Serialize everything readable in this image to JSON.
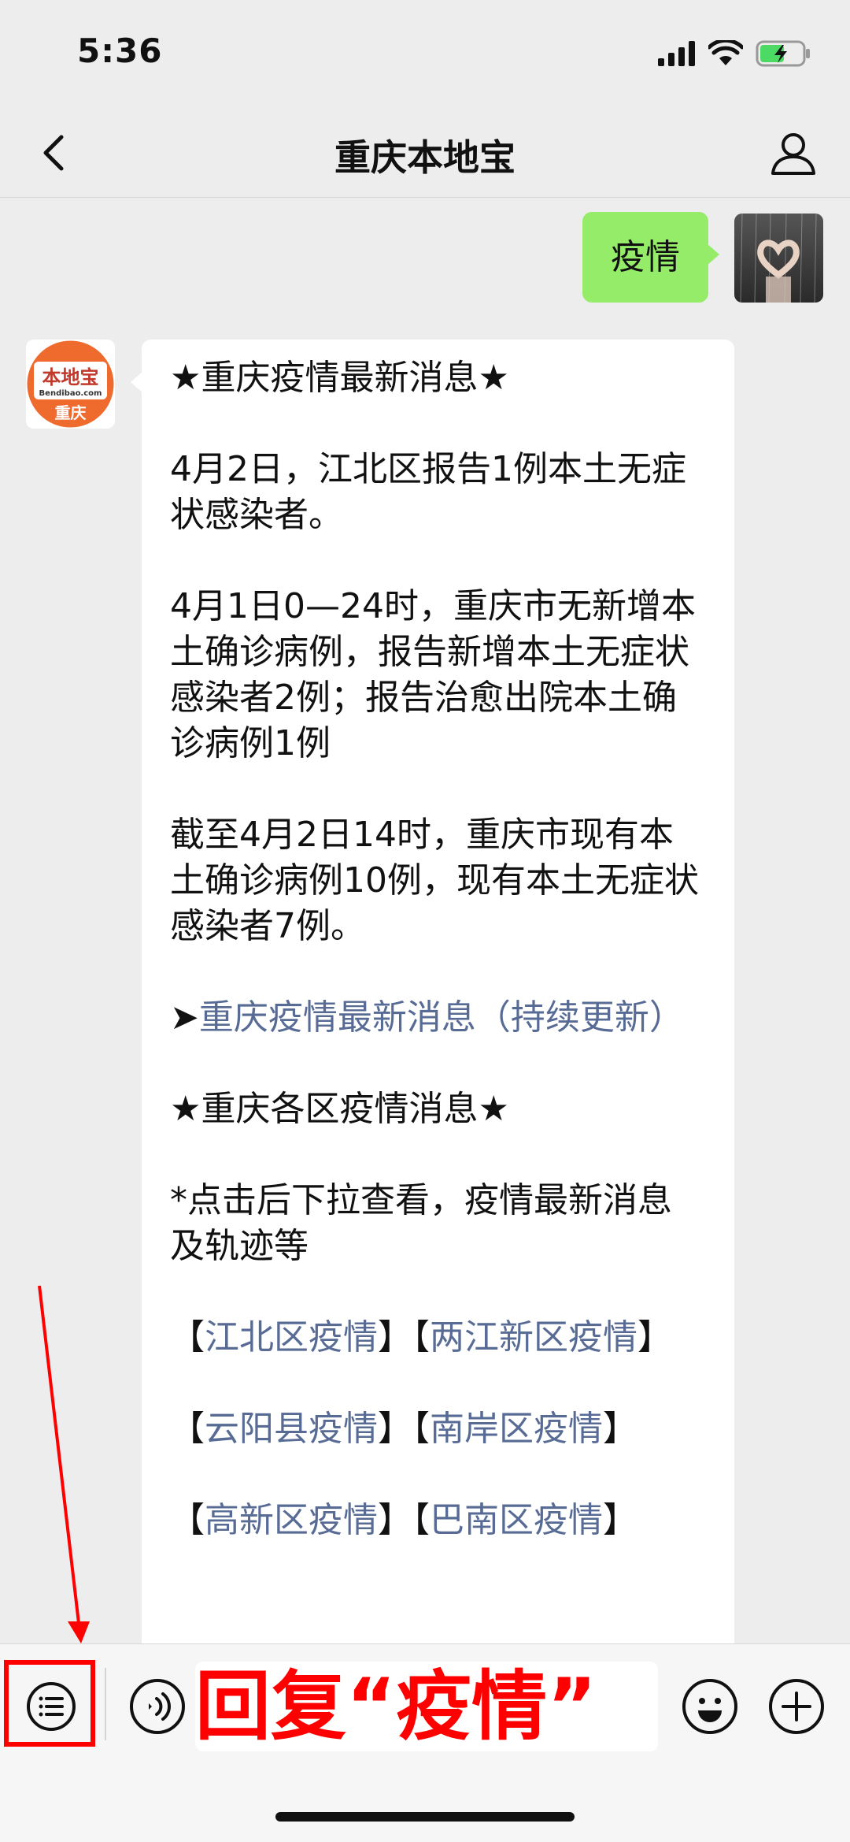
{
  "status_bar": {
    "time": "5:36"
  },
  "nav": {
    "title": "重庆本地宝"
  },
  "messages": {
    "user_text": "疫情",
    "bot_avatar": {
      "brand": "本地宝",
      "site": "Bendibao.com",
      "city": "重庆"
    },
    "bot": {
      "p1": "★重庆疫情最新消息★",
      "p2": "4月2日，江北区报告1例本土无症状感染者。",
      "p3": "4月1日0—24时，重庆市无新增本土确诊病例，报告新增本土无症状感染者2例；报告治愈出院本土确诊病例1例",
      "p4": "截至4月2日14时，重庆市现有本土确诊病例10例，现有本土无症状感染者7例。",
      "p5_prefix": "➤",
      "p5_link": "重庆疫情最新消息（持续更新）",
      "p6": "★重庆各区疫情消息★",
      "p7": "*点击后下拉查看，疫情最新消息及轨迹等",
      "districts": [
        {
          "name": "江北区疫情"
        },
        {
          "name": "两江新区疫情"
        },
        {
          "name": "云阳县疫情"
        },
        {
          "name": "南岸区疫情"
        },
        {
          "name": "高新区疫情"
        },
        {
          "name": "巴南区疫情"
        }
      ],
      "bracket_open": "【",
      "bracket_close": "】"
    }
  },
  "input_bar": {
    "reply_hint": "回复“疫情”"
  },
  "colors": {
    "user_bubble": "#95ec69",
    "link": "#576b95",
    "annotation": "#ff0000",
    "background": "#ededed"
  }
}
